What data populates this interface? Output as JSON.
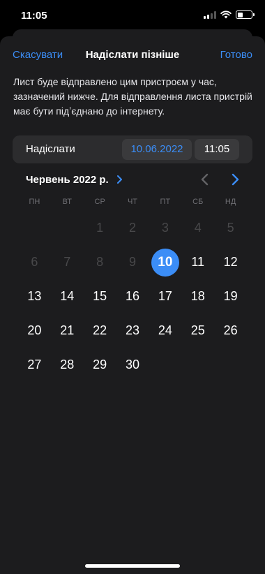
{
  "status_bar": {
    "time": "11:05"
  },
  "nav": {
    "cancel_label": "Скасувати",
    "title": "Надіслати пізніше",
    "done_label": "Готово"
  },
  "description": "Лист буде відправлено цим пристроєм у час, зазначений нижче. Для відправлення листа пристрій має бути підʼєднано до інтернету.",
  "send_row": {
    "label": "Надіслати",
    "date": "10.06.2022",
    "time": "11:05"
  },
  "calendar": {
    "month_label": "Червень 2022 р.",
    "weekdays": [
      "ПН",
      "ВТ",
      "СР",
      "ЧТ",
      "ПТ",
      "СБ",
      "НД"
    ],
    "selected_day": "10",
    "days": [
      {
        "label": "",
        "state": "empty"
      },
      {
        "label": "",
        "state": "empty"
      },
      {
        "label": "1",
        "state": "disabled"
      },
      {
        "label": "2",
        "state": "disabled"
      },
      {
        "label": "3",
        "state": "disabled"
      },
      {
        "label": "4",
        "state": "disabled"
      },
      {
        "label": "5",
        "state": "disabled"
      },
      {
        "label": "6",
        "state": "disabled"
      },
      {
        "label": "7",
        "state": "disabled"
      },
      {
        "label": "8",
        "state": "disabled"
      },
      {
        "label": "9",
        "state": "disabled"
      },
      {
        "label": "10",
        "state": "selected"
      },
      {
        "label": "11",
        "state": "enabled"
      },
      {
        "label": "12",
        "state": "enabled"
      },
      {
        "label": "13",
        "state": "enabled"
      },
      {
        "label": "14",
        "state": "enabled"
      },
      {
        "label": "15",
        "state": "enabled"
      },
      {
        "label": "16",
        "state": "enabled"
      },
      {
        "label": "17",
        "state": "enabled"
      },
      {
        "label": "18",
        "state": "enabled"
      },
      {
        "label": "19",
        "state": "enabled"
      },
      {
        "label": "20",
        "state": "enabled"
      },
      {
        "label": "21",
        "state": "enabled"
      },
      {
        "label": "22",
        "state": "enabled"
      },
      {
        "label": "23",
        "state": "enabled"
      },
      {
        "label": "24",
        "state": "enabled"
      },
      {
        "label": "25",
        "state": "enabled"
      },
      {
        "label": "26",
        "state": "enabled"
      },
      {
        "label": "27",
        "state": "enabled"
      },
      {
        "label": "28",
        "state": "enabled"
      },
      {
        "label": "29",
        "state": "enabled"
      },
      {
        "label": "30",
        "state": "enabled"
      }
    ]
  },
  "colors": {
    "accent": "#3b8df6",
    "sheet_background": "#1c1c1e",
    "row_background": "#2c2c2e",
    "disabled_text": "#48484a"
  },
  "icons": [
    "signal-icon",
    "wifi-icon",
    "battery-icon",
    "chevron-right-icon",
    "chevron-left-icon"
  ]
}
